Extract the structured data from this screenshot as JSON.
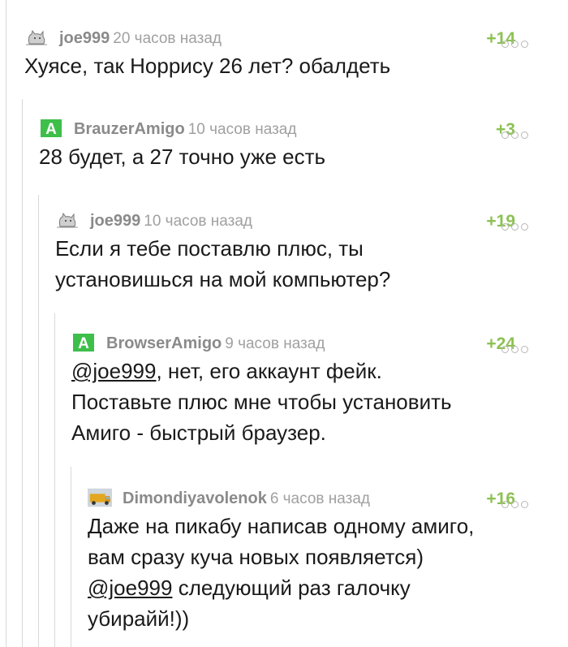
{
  "comments": [
    {
      "author": "joe999",
      "time": "20 часов назад",
      "rating": "+14",
      "avatar": "cat-avatar-icon",
      "text": "Хуясе, так Норрису 26 лет? обалдеть"
    },
    {
      "author": "BrauzerAmigo",
      "time": "10 часов назад",
      "rating": "+3",
      "avatar": "amigo-logo-icon",
      "text": "28 будет, а 27 точно уже есть"
    },
    {
      "author": "joe999",
      "time": "10 часов назад",
      "rating": "+19",
      "avatar": "cat-avatar-icon",
      "text": "Если я тебе поставлю плюс, ты\nустановишься на мой компьютер?"
    },
    {
      "author": "BrowserAmigo",
      "time": "9 часов назад",
      "rating": "+24",
      "avatar": "amigo-logo-icon",
      "mention": "@joe999",
      "text": ", нет, его аккаунт фейк.\nПоставьте плюс мне чтобы установить\nАмиго - быстрый браузер."
    },
    {
      "author": "Dimondiyavolenok",
      "time": "6 часов назад",
      "rating": "+16",
      "avatar": "truck-avatar-icon",
      "text_before": "Даже на пикабу написав одному амиго,\nвам сразу куча новых появляется)\n",
      "mention": "@joe999",
      "text_after": " следующий раз галочку\nубирайй!))"
    }
  ],
  "colors": {
    "rating": "#8cc152",
    "author": "#8a8a8a",
    "amigo_green": "#3dbf4a"
  }
}
